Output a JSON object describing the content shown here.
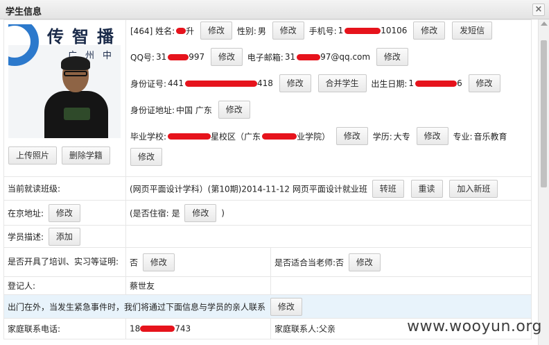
{
  "window": {
    "title": "学生信息",
    "close_label": "×"
  },
  "photo": {
    "logo_text": "传智播",
    "logo_sub": "广州中",
    "upload_label": "上传照片",
    "delete_label": "删除学籍"
  },
  "student": {
    "id_prefix": "[464] 姓名:",
    "name_visible": "升",
    "name_edit": "修改",
    "gender_label": "性别:",
    "gender_value": "男",
    "gender_edit": "修改",
    "phone_label": "手机号:",
    "phone_prefix": "1",
    "phone_suffix": "10106",
    "phone_edit": "修改",
    "sms_label": "发短信",
    "qq_label": "QQ号:",
    "qq_prefix": "31",
    "qq_suffix": "997",
    "qq_edit": "修改",
    "email_label": "电子邮箱:",
    "email_prefix": "31",
    "email_suffix": "97@qq.com",
    "email_edit": "修改",
    "idcard_label": "身份证号:",
    "idcard_prefix": "441",
    "idcard_suffix": "418",
    "idcard_edit": "修改",
    "merge_label": "合并学生",
    "birth_label": "出生日期:",
    "birth_prefix": "1",
    "birth_suffix": "6",
    "birth_edit": "修改",
    "idaddr_label": "身份证地址:",
    "idaddr_value": "中国 广东",
    "idaddr_edit": "修改",
    "school_label": "毕业学校:",
    "school_mid": "星校区（广东",
    "school_suffix": "业学院）",
    "school_edit": "修改",
    "edu_label": "学历:",
    "edu_value": "大专",
    "edu_edit": "修改",
    "major_label": "专业:",
    "major_value": "音乐教育",
    "major_edit": "修改"
  },
  "class_row": {
    "label": "当前就读班级:",
    "value": "(网页平面设计学科）(第10期)2014-11-12 网页平面设计就业班",
    "transfer": "转班",
    "reread": "重读",
    "add_class": "加入新班"
  },
  "beijing_row": {
    "label": "在京地址:",
    "edit": "修改",
    "lodging_prefix": "(是否住宿:",
    "lodging_value": "是",
    "lodging_edit": "修改",
    "lodging_suffix": ")"
  },
  "desc_row": {
    "label": "学员描述:",
    "add": "添加"
  },
  "cert_row": {
    "label": "是否开具了培训、实习等证明:",
    "value": "否",
    "edit": "修改",
    "teacher_label": "是否适合当老师:",
    "teacher_value": "否",
    "teacher_edit": "修改"
  },
  "registrar_row": {
    "label": "登记人:",
    "value": "蔡世友"
  },
  "emergency_row": {
    "text": "出门在外，当发生紧急事件时，我们将通过下面信息与学员的亲人联系",
    "edit": "修改"
  },
  "family_row": {
    "phone_label": "家庭联系电话:",
    "phone_prefix": "18",
    "phone_suffix": "743",
    "contact_label": "家庭联系人:",
    "contact_value": "父亲"
  },
  "watermark": "www.wooyun.org",
  "colors": {
    "redaction": "#e6131c",
    "highlight_row": "#e8f3fb",
    "logo_blue": "#2c79cc"
  }
}
